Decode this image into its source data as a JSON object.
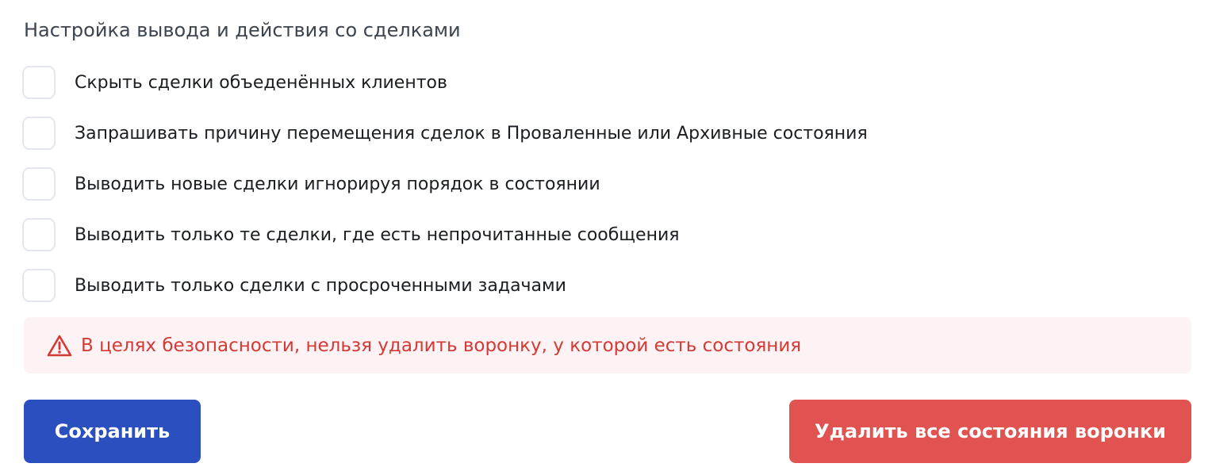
{
  "section": {
    "title": "Настройка вывода и действия со сделками"
  },
  "options": [
    {
      "label": "Скрыть сделки объеденённых клиентов",
      "checked": false
    },
    {
      "label": "Запрашивать причину перемещения сделок в Проваленные или Архивные состояния",
      "checked": false
    },
    {
      "label": "Выводить новые сделки игнорируя порядок в состоянии",
      "checked": false
    },
    {
      "label": "Выводить только те сделки, где есть непрочитанные сообщения",
      "checked": false
    },
    {
      "label": "Выводить только сделки с просроченными задачами",
      "checked": false
    }
  ],
  "alert": {
    "icon": "warning-triangle-icon",
    "text": "В целях безопасности, нельзя удалить воронку, у которой есть состояния",
    "color": "#d43a35",
    "background": "#fdf2f4"
  },
  "buttons": {
    "save_label": "Сохранить",
    "delete_label": "Удалить все состояния воронки"
  },
  "colors": {
    "primary": "#2b4fbe",
    "danger": "#e05350"
  }
}
